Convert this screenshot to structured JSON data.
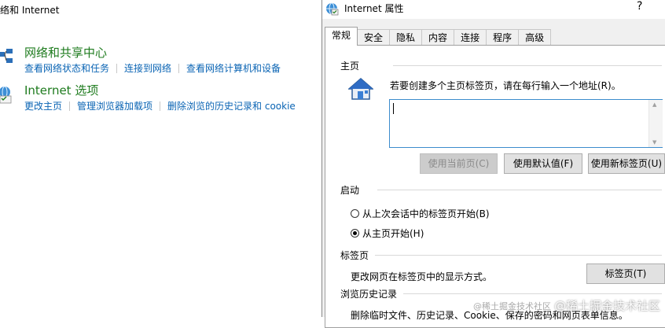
{
  "control_panel": {
    "title": "络和 Internet",
    "network": {
      "heading": "网络和共享中心",
      "links": [
        "查看网络状态和任务",
        "连接到网络",
        "查看网络计算机和设备"
      ]
    },
    "internet": {
      "heading": "Internet 选项",
      "links": [
        "更改主页",
        "管理浏览器加载项",
        "删除浏览的历史记录和 cookie"
      ]
    }
  },
  "dialog": {
    "title": "Internet 属性",
    "help": "?",
    "tabs": [
      "常规",
      "安全",
      "隐私",
      "内容",
      "连接",
      "程序",
      "高级"
    ],
    "home": {
      "label": "主页",
      "hint": "若要创建多个主页标签页，请在每行输入一个地址(R)。",
      "url_value": "",
      "buttons": {
        "use_current": "使用当前页(C)",
        "use_default": "使用默认值(F)",
        "use_new_tab": "使用新标签页(U)"
      }
    },
    "startup": {
      "label": "启动",
      "option_last": "从上次会话中的标签页开始(B)",
      "option_home": "从主页开始(H)",
      "selected": "option_home"
    },
    "tabs_section": {
      "label": "标签页",
      "description": "更改网页在标签页中的显示方式。",
      "button": "标签页(T)"
    },
    "history": {
      "label": "浏览历史记录",
      "description": "删除临时文件、历史记录、Cookie、保存的密码和网页表单信息。"
    }
  },
  "watermark": {
    "small": "@稀土掘金技术社区",
    "text": "@稀土掘金技术社区"
  }
}
